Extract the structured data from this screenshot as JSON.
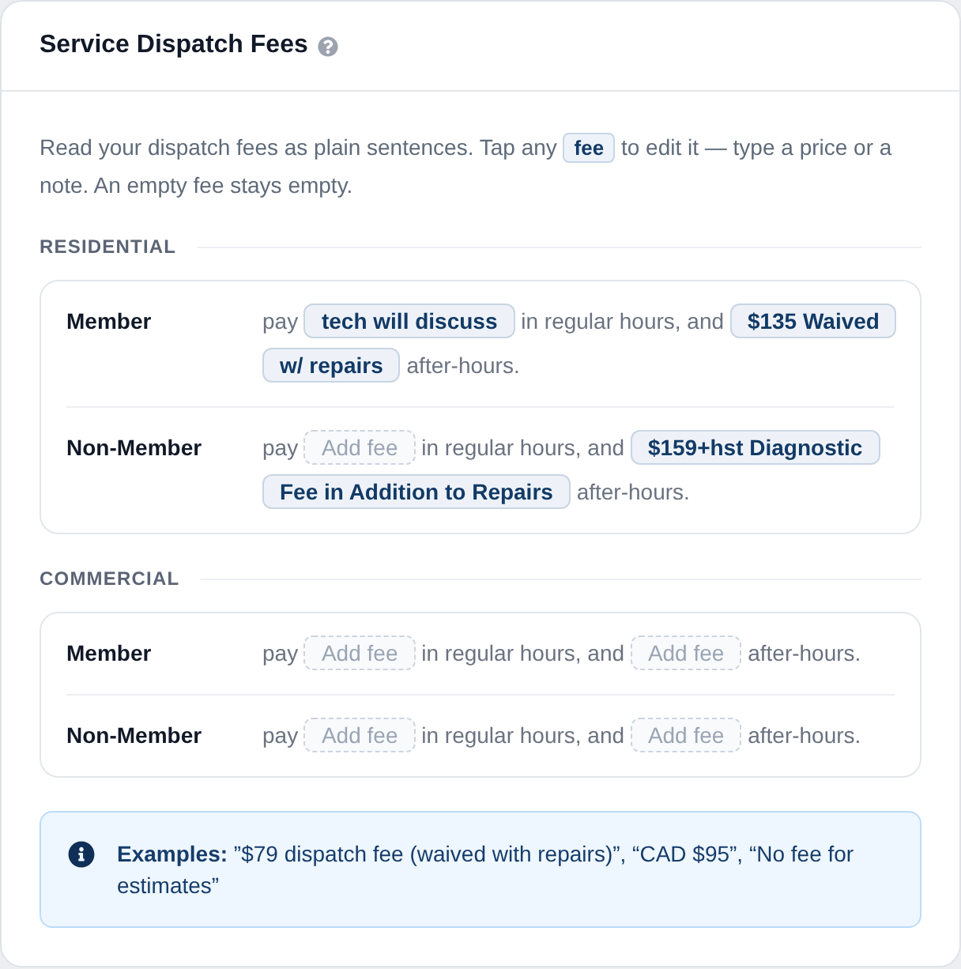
{
  "header": {
    "title": "Service Dispatch Fees"
  },
  "intro": {
    "before": "Read your dispatch fees as plain sentences. Tap any",
    "chip": "fee",
    "after": "to edit it — type a price or a note. An empty fee stays empty."
  },
  "sections": [
    {
      "title": "RESIDENTIAL",
      "rows": [
        {
          "label": "Member",
          "lead": "pay",
          "regular_fee": {
            "parts": [
              "tech will discuss"
            ]
          },
          "middle": "in regular hours, and",
          "after_hours_fee": {
            "parts": [
              "$135 Waived",
              "w/ repairs"
            ]
          },
          "tail": "after-hours."
        },
        {
          "label": "Non-Member",
          "lead": "pay",
          "regular_fee": {
            "placeholder": "Add fee"
          },
          "middle": "in regular hours, and",
          "after_hours_fee": {
            "parts": [
              "$159+hst Diagnostic",
              "Fee in Addition to Repairs"
            ]
          },
          "tail": "after-hours."
        }
      ]
    },
    {
      "title": "COMMERCIAL",
      "rows": [
        {
          "label": "Member",
          "lead": "pay",
          "regular_fee": {
            "placeholder": "Add fee"
          },
          "middle": "in regular hours, and",
          "after_hours_fee": {
            "placeholder": "Add fee"
          },
          "tail": "after-hours."
        },
        {
          "label": "Non-Member",
          "lead": "pay",
          "regular_fee": {
            "placeholder": "Add fee"
          },
          "middle": "in regular hours, and",
          "after_hours_fee": {
            "placeholder": "Add fee"
          },
          "tail": "after-hours."
        }
      ]
    }
  ],
  "note": {
    "text": "**Examples:** ”$79 dispatch fee (waived with repairs)”, “CAD $95”, “No fee for estimates”"
  }
}
